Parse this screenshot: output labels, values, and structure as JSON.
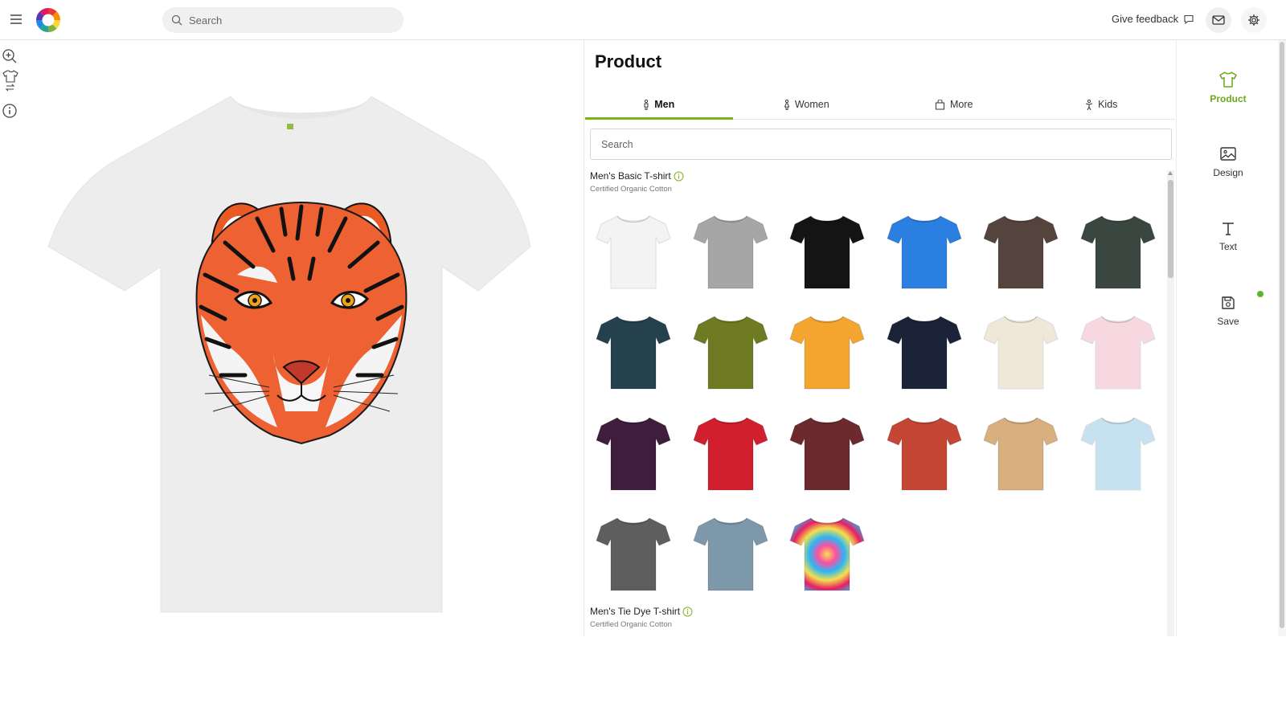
{
  "topbar": {
    "search_placeholder": "Search",
    "feedback_label": "Give feedback",
    "icons": [
      "hamburger-icon",
      "logo",
      "search-icon",
      "chat-icon",
      "mail-icon",
      "gear-icon"
    ]
  },
  "tools": [
    "zoom-in-icon",
    "swap-shirt-icon",
    "info-icon"
  ],
  "preview": {
    "shirt_color": "#eeeeee",
    "print": "tiger face illustration"
  },
  "panel": {
    "title": "Product",
    "tabs": [
      {
        "label": "Men",
        "icon": "man-icon",
        "active": true
      },
      {
        "label": "Women",
        "icon": "woman-icon",
        "active": false
      },
      {
        "label": "More",
        "icon": "bag-icon",
        "active": false
      },
      {
        "label": "Kids",
        "icon": "child-icon",
        "active": false
      }
    ],
    "search_placeholder": "Search",
    "groups": [
      {
        "name": "Men's Basic T-shirt",
        "subtitle": "Certified Organic Cotton",
        "colors": [
          "#f3f3f3",
          "#a6a6a6",
          "#141414",
          "#2b7fe0",
          "#55443d",
          "#3a4740",
          "#25414d",
          "#6f7b23",
          "#f4a530",
          "#1a2337",
          "#efe7d8",
          "#f7d7e0",
          "#3f1d3d",
          "#d11f2e",
          "#6c2a2e",
          "#c34734",
          "#d8b080",
          "#c6e2f0",
          "#5e5e5e",
          "#7d97ab",
          "tie-dye"
        ]
      },
      {
        "name": "Men's Tie Dye T-shirt",
        "subtitle": "Certified Organic Cotton",
        "colors": []
      }
    ]
  },
  "rightnav": [
    {
      "label": "Product",
      "icon": "tshirt-icon",
      "active": true
    },
    {
      "label": "Design",
      "icon": "image-icon",
      "active": false
    },
    {
      "label": "Text",
      "icon": "text-icon",
      "active": false
    },
    {
      "label": "Save",
      "icon": "save-icon",
      "active": false
    }
  ],
  "colors": {
    "accent": "#7ab317",
    "status_dot": "#5cb432"
  }
}
